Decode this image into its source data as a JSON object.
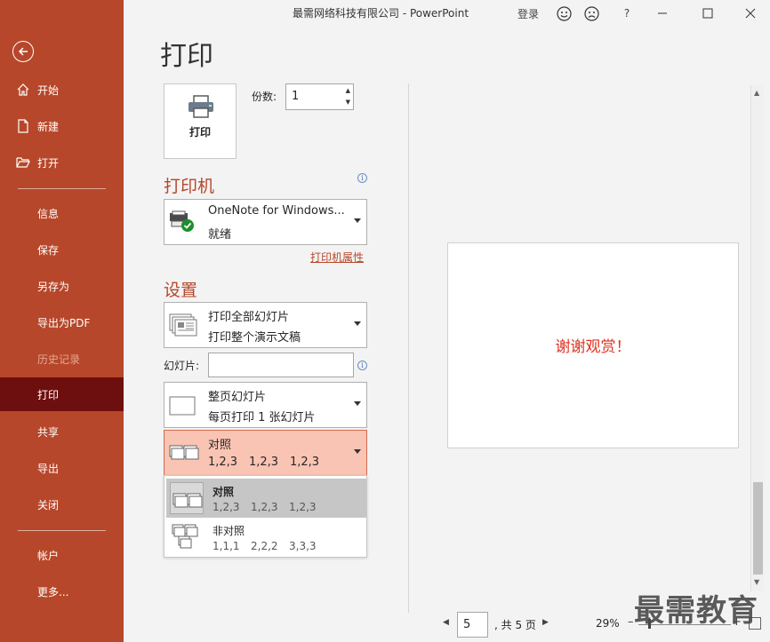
{
  "app": {
    "title": "最需网络科技有限公司  -  PowerPoint",
    "signin": "登录",
    "help": "?"
  },
  "sidebar": {
    "items": [
      {
        "label": "开始",
        "icon": "home-icon"
      },
      {
        "label": "新建",
        "icon": "new-doc-icon"
      },
      {
        "label": "打开",
        "icon": "folder-open-icon"
      },
      {
        "label": "信息"
      },
      {
        "label": "保存"
      },
      {
        "label": "另存为"
      },
      {
        "label": "导出为PDF"
      },
      {
        "label": "历史记录",
        "disabled": true
      },
      {
        "label": "打印",
        "active": true
      },
      {
        "label": "共享"
      },
      {
        "label": "导出"
      },
      {
        "label": "关闭"
      },
      {
        "label": "帐户"
      },
      {
        "label": "更多..."
      }
    ]
  },
  "print": {
    "page_title": "打印",
    "print_button": "打印",
    "copies_label": "份数:",
    "copies_value": "1"
  },
  "printer": {
    "heading": "打印机",
    "name": "OneNote for Windows...",
    "status": "就绪",
    "properties_link": "打印机属性"
  },
  "settings": {
    "heading": "设置",
    "range_title": "打印全部幻灯片",
    "range_sub": "打印整个演示文稿",
    "slides_label": "幻灯片:",
    "slides_value": "",
    "layout_title": "整页幻灯片",
    "layout_sub": "每页打印 1 张幻灯片",
    "collate_title": "对照",
    "collate_nums": [
      "1,2,3",
      "1,2,3",
      "1,2,3"
    ],
    "options": [
      {
        "title": "对照",
        "nums": [
          "1,2,3",
          "1,2,3",
          "1,2,3"
        ],
        "selected": true
      },
      {
        "title": "非对照",
        "nums": [
          "1,1,1",
          "2,2,2",
          "3,3,3"
        ],
        "selected": false
      }
    ]
  },
  "preview": {
    "slide_text": "谢谢观赏！",
    "current_page": "5",
    "total_pages": ", 共 5 页",
    "zoom": "29%"
  },
  "watermark": "最需教育",
  "colors": {
    "accent": "#b7472a",
    "active_nav": "#6e0f0f",
    "collate_bg": "#f9c4b3",
    "slide_text": "#e0301e"
  }
}
